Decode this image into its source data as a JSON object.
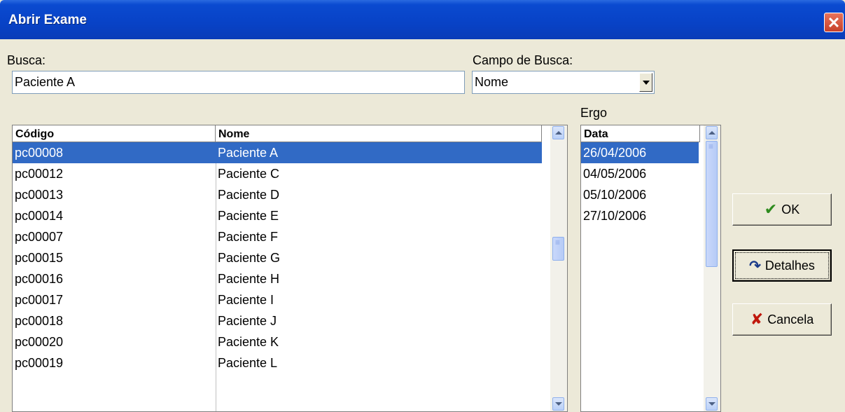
{
  "window": {
    "title": "Abrir Exame",
    "close_glyph": "✕"
  },
  "search": {
    "label": "Busca:",
    "value": "Paciente A"
  },
  "field": {
    "label": "Campo de Busca:",
    "value": "Nome"
  },
  "patients": {
    "headers": [
      "Código",
      "Nome"
    ],
    "rows": [
      [
        "pc00008",
        "Paciente A"
      ],
      [
        "pc00012",
        "Paciente C"
      ],
      [
        "pc00013",
        "Paciente D"
      ],
      [
        "pc00014",
        "Paciente E"
      ],
      [
        "pc00007",
        "Paciente F"
      ],
      [
        "pc00015",
        "Paciente G"
      ],
      [
        "pc00016",
        "Paciente H"
      ],
      [
        "pc00017",
        "Paciente I"
      ],
      [
        "pc00018",
        "Paciente J"
      ],
      [
        "pc00020",
        "Paciente K"
      ],
      [
        "pc00019",
        "Paciente L"
      ]
    ],
    "selected_index": 0
  },
  "exams": {
    "label": "Ergo",
    "header": "Data",
    "rows": [
      "26/04/2006",
      "04/05/2006",
      "05/10/2006",
      "27/10/2006"
    ],
    "selected_index": 0
  },
  "buttons": {
    "ok": {
      "label": "OK",
      "icon": "check-icon",
      "glyph": "✔",
      "color": "#2e8b1e"
    },
    "details": {
      "label": "Detalhes",
      "icon": "refresh-icon",
      "glyph": "↷",
      "color": "#1a3a8a"
    },
    "cancel": {
      "label": "Cancela",
      "icon": "x-icon",
      "glyph": "✘",
      "color": "#c0180c"
    }
  }
}
